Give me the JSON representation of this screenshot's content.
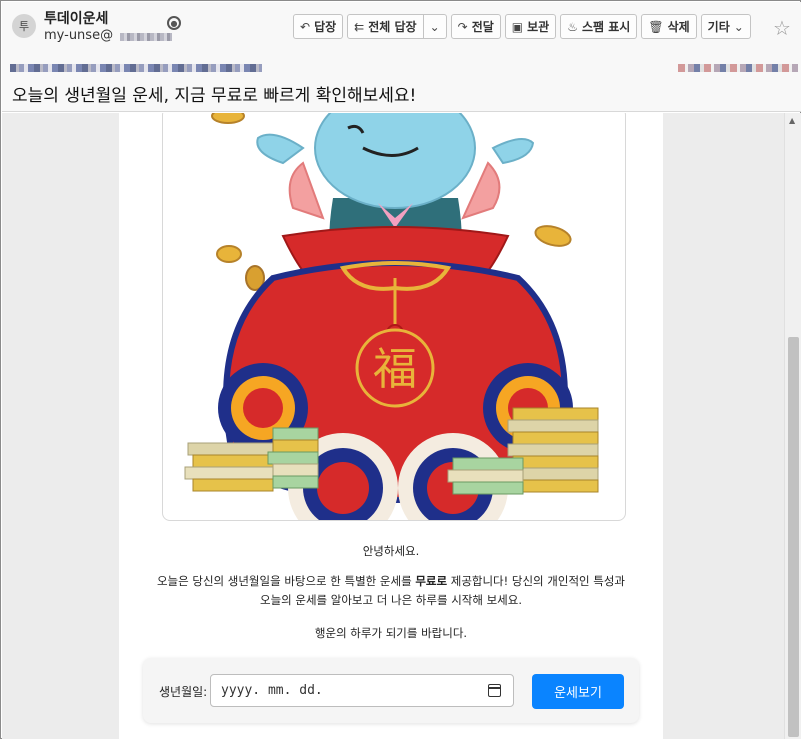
{
  "sender": {
    "avatar_initial": "투",
    "name": "투데이운세",
    "email_prefix": "my-unse@"
  },
  "toolbar": {
    "reply": "답장",
    "reply_all": "전체 답장",
    "forward": "전달",
    "archive": "보관",
    "spam": "스팸 표시",
    "delete": "삭제",
    "more": "기타"
  },
  "subject": "오늘의 생년월일 운세, 지금 무료로 빠르게 확인해보세요!",
  "hero": {
    "bag_character": "福"
  },
  "body": {
    "greeting": "안녕하세요.",
    "paragraph_before": "오늘은 당신의 생년월일을 바탕으로 한 특별한 운세를 ",
    "paragraph_bold": "무료로",
    "paragraph_after": " 제공합니다! 당신의 개인적인 특성과",
    "paragraph_line2": "오늘의 운세를 알아보고 더 나은 하루를 시작해 보세요.",
    "closing": "행운의 하루가 되기를 바랍니다."
  },
  "form": {
    "label": "생년월일:",
    "date_placeholder": "yyyy. mm. dd.",
    "submit": "운세보기"
  },
  "colors": {
    "accent": "#0a84ff",
    "bag_red": "#d62a2a",
    "gold": "#e8b43a",
    "navy": "#1f2f8a"
  }
}
